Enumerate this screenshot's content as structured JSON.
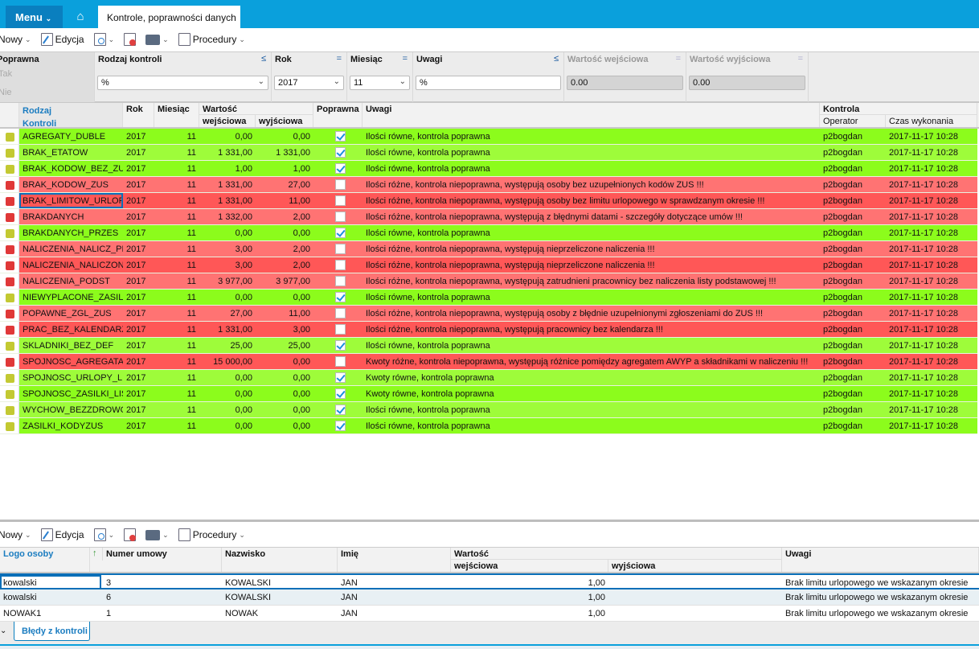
{
  "topbar": {
    "menu": "Menu",
    "tab": "Kontrole, poprawności danych"
  },
  "toolbar": {
    "new": "Nowy",
    "edit": "Edycja",
    "procedures": "Procedury"
  },
  "filter": {
    "poprawna_label": "Poprawna",
    "poprawna_opt_yes": "Tak",
    "poprawna_opt_no": "Nie",
    "rodzaj_label": "Rodzaj kontroli",
    "rodzaj_value": "%",
    "rodzaj_op": "≤",
    "rok_label": "Rok",
    "rok_value": "2017",
    "rok_op": "=",
    "miesiac_label": "Miesiąc",
    "miesiac_value": "11",
    "miesiac_op": "=",
    "uwagi_label": "Uwagi",
    "uwagi_value": "%",
    "uwagi_op": "≤",
    "wej_label": "Wartość wejściowa",
    "wej_value": "0.00",
    "wej_op": "=",
    "wyj_label": "Wartość wyjściowa",
    "wyj_value": "0.00",
    "wyj_op": "="
  },
  "grid": {
    "headers": {
      "rodzaj1": "Rodzaj",
      "rodzaj2": "Kontroli",
      "rok": "Rok",
      "miesiac": "Miesiąc",
      "wartosc": "Wartość",
      "wej": "wejściowa",
      "wyj": "wyjściowa",
      "poprawna": "Poprawna",
      "uwagi": "Uwagi",
      "kontrola": "Kontrola",
      "operator": "Operator",
      "czas": "Czas wykonania"
    },
    "colors": {
      "ok_dark": "#8cfc1c",
      "ok_light": "#9efc3a",
      "bad_dark": "#ff5757",
      "bad_light": "#ff7373",
      "ok_marker": "#c3c932",
      "bad_marker": "#e03838"
    },
    "rows": [
      {
        "name": "AGREGATY_DUBLE",
        "rok": "2017",
        "mies": "11",
        "wej": "0,00",
        "wyj": "0,00",
        "ok": true,
        "uwagi": "Ilości równe, kontrola poprawna",
        "op": "p2bogdan",
        "czas": "2017-11-17 10:28"
      },
      {
        "name": "BRAK_ETATOW",
        "rok": "2017",
        "mies": "11",
        "wej": "1 331,00",
        "wyj": "1 331,00",
        "ok": true,
        "uwagi": "Ilości równe, kontrola poprawna",
        "op": "p2bogdan",
        "czas": "2017-11-17 10:28"
      },
      {
        "name": "BRAK_KODOW_BEZ_ZUS",
        "rok": "2017",
        "mies": "11",
        "wej": "1,00",
        "wyj": "1,00",
        "ok": true,
        "uwagi": "Ilości równe, kontrola poprawna",
        "op": "p2bogdan",
        "czas": "2017-11-17 10:28"
      },
      {
        "name": "BRAK_KODOW_ZUS",
        "rok": "2017",
        "mies": "11",
        "wej": "1 331,00",
        "wyj": "27,00",
        "ok": false,
        "uwagi": "Ilości różne, kontrola niepoprawna, występują osoby bez uzupełnionych kodów ZUS !!!",
        "op": "p2bogdan",
        "czas": "2017-11-17 10:28"
      },
      {
        "name": "BRAK_LIMITOW_URLOP",
        "rok": "2017",
        "mies": "11",
        "wej": "1 331,00",
        "wyj": "11,00",
        "ok": false,
        "uwagi": "Ilości różne, kontrola niepoprawna, występują osoby bez limitu urlopowego w sprawdzanym okresie !!!",
        "op": "p2bogdan",
        "czas": "2017-11-17 10:28"
      },
      {
        "name": "BRAKDANYCH",
        "rok": "2017",
        "mies": "11",
        "wej": "1 332,00",
        "wyj": "2,00",
        "ok": false,
        "uwagi": "Ilości różne, kontrola niepoprawna, występują z błędnymi datami - szczegóły dotyczące umów !!!",
        "op": "p2bogdan",
        "czas": "2017-11-17 10:28"
      },
      {
        "name": "BRAKDANYCH_PRZES",
        "rok": "2017",
        "mies": "11",
        "wej": "0,00",
        "wyj": "0,00",
        "ok": true,
        "uwagi": "Ilości równe, kontrola poprawna",
        "op": "p2bogdan",
        "czas": "2017-11-17 10:28"
      },
      {
        "name": "NALICZENIA_NALICZ_PR",
        "rok": "2017",
        "mies": "11",
        "wej": "3,00",
        "wyj": "2,00",
        "ok": false,
        "uwagi": "Ilości różne, kontrola niepoprawna, występują nieprzeliczone naliczenia !!!",
        "op": "p2bogdan",
        "czas": "2017-11-17 10:28"
      },
      {
        "name": "NALICZENIA_NALICZONE",
        "rok": "2017",
        "mies": "11",
        "wej": "3,00",
        "wyj": "2,00",
        "ok": false,
        "uwagi": "Ilości różne, kontrola niepoprawna, występują nieprzeliczone naliczenia !!!",
        "op": "p2bogdan",
        "czas": "2017-11-17 10:28"
      },
      {
        "name": "NALICZENIA_PODST",
        "rok": "2017",
        "mies": "11",
        "wej": "3 977,00",
        "wyj": "3 977,00",
        "ok": false,
        "uwagi": "Ilości różne, kontrola niepoprawna, występują zatrudnieni pracownicy bez naliczenia listy podstawowej !!!",
        "op": "p2bogdan",
        "czas": "2017-11-17 10:28"
      },
      {
        "name": "NIEWYPLACONE_ZASILK",
        "rok": "2017",
        "mies": "11",
        "wej": "0,00",
        "wyj": "0,00",
        "ok": true,
        "uwagi": "Ilości równe, kontrola poprawna",
        "op": "p2bogdan",
        "czas": "2017-11-17 10:28"
      },
      {
        "name": "POPAWNE_ZGL_ZUS",
        "rok": "2017",
        "mies": "11",
        "wej": "27,00",
        "wyj": "11,00",
        "ok": false,
        "uwagi": "Ilości różne, kontrola niepoprawna, występują osoby z błędnie uzupełnionymi zgłoszeniami do ZUS !!!",
        "op": "p2bogdan",
        "czas": "2017-11-17 10:28"
      },
      {
        "name": "PRAC_BEZ_KALENDARZ",
        "rok": "2017",
        "mies": "11",
        "wej": "1 331,00",
        "wyj": "3,00",
        "ok": false,
        "uwagi": "Ilości różne, kontrola niepoprawna, występują pracownicy bez kalendarza !!!",
        "op": "p2bogdan",
        "czas": "2017-11-17 10:28"
      },
      {
        "name": "SKLADNIKI_BEZ_DEF",
        "rok": "2017",
        "mies": "11",
        "wej": "25,00",
        "wyj": "25,00",
        "ok": true,
        "uwagi": "Ilości równe, kontrola poprawna",
        "op": "p2bogdan",
        "czas": "2017-11-17 10:28"
      },
      {
        "name": "SPOJNOSC_AGREGATAW",
        "rok": "2017",
        "mies": "11",
        "wej": "15 000,00",
        "wyj": "0,00",
        "ok": false,
        "uwagi": "Kwoty różne, kontrola niepoprawna, występują różnice pomiędzy agregatem AWYP a składnikami w naliczeniu !!!",
        "op": "p2bogdan",
        "czas": "2017-11-17 10:28"
      },
      {
        "name": "SPOJNOSC_URLOPY_LIS",
        "rok": "2017",
        "mies": "11",
        "wej": "0,00",
        "wyj": "0,00",
        "ok": true,
        "uwagi": "Kwoty równe, kontrola poprawna",
        "op": "p2bogdan",
        "czas": "2017-11-17 10:28"
      },
      {
        "name": "SPOJNOSC_ZASILKI_LIS",
        "rok": "2017",
        "mies": "11",
        "wej": "0,00",
        "wyj": "0,00",
        "ok": true,
        "uwagi": "Kwoty równe, kontrola poprawna",
        "op": "p2bogdan",
        "czas": "2017-11-17 10:28"
      },
      {
        "name": "WYCHOW_BEZZDROWOT",
        "rok": "2017",
        "mies": "11",
        "wej": "0,00",
        "wyj": "0,00",
        "ok": true,
        "uwagi": "Ilości równe, kontrola poprawna",
        "op": "p2bogdan",
        "czas": "2017-11-17 10:28"
      },
      {
        "name": "ZASILKI_KODYZUS",
        "rok": "2017",
        "mies": "11",
        "wej": "0,00",
        "wyj": "0,00",
        "ok": true,
        "uwagi": "Ilości równe, kontrola poprawna",
        "op": "p2bogdan",
        "czas": "2017-11-17 10:28"
      }
    ]
  },
  "detail": {
    "headers": {
      "logo": "Logo osoby",
      "numer": "Numer umowy",
      "nazwisko": "Nazwisko",
      "imie": "Imię",
      "wartosc": "Wartość",
      "wej": "wejściowa",
      "wyj": "wyjściowa",
      "uwagi": "Uwagi"
    },
    "rows": [
      {
        "logo": "kowalski",
        "numer": "3",
        "nazwisko": "KOWALSKI",
        "imie": "JAN",
        "wej": "1,00",
        "wyj": "",
        "uwagi": "Brak limitu urlopowego we wskazanym okresie"
      },
      {
        "logo": "kowalski",
        "numer": "6",
        "nazwisko": "KOWALSKI",
        "imie": "JAN",
        "wej": "1,00",
        "wyj": "",
        "uwagi": "Brak limitu urlopowego we wskazanym okresie"
      },
      {
        "logo": "NOWAK1",
        "numer": "1",
        "nazwisko": "NOWAK",
        "imie": "JAN",
        "wej": "1,00",
        "wyj": "",
        "uwagi": "Brak limitu urlopowego we wskazanym okresie"
      }
    ],
    "tab": "Błędy z kontroli"
  }
}
